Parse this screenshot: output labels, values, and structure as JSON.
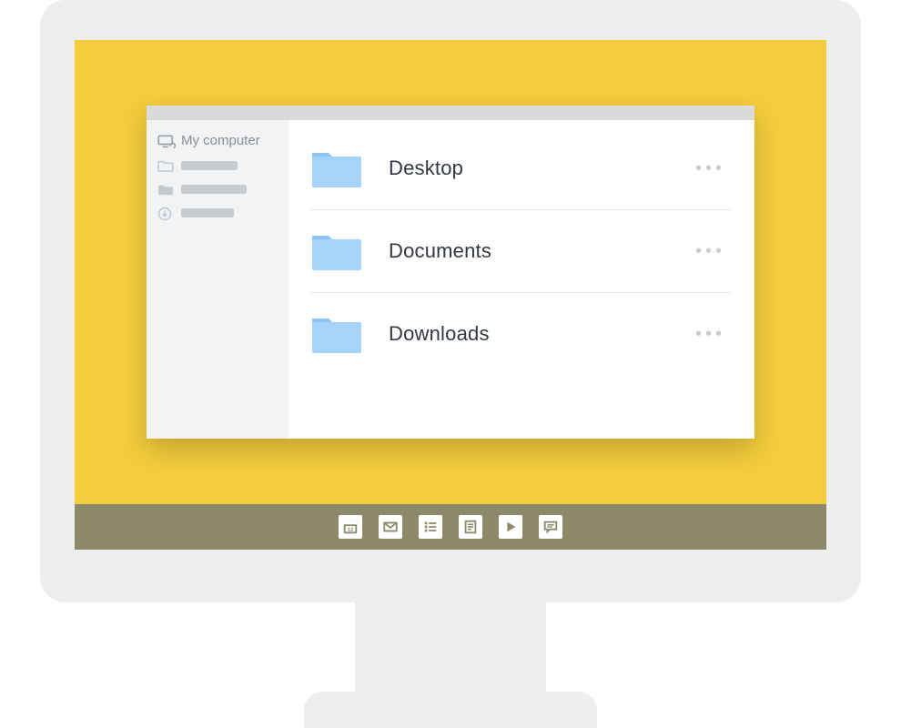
{
  "sidebar": {
    "primary_label": "My computer"
  },
  "folders": [
    {
      "label": "Desktop"
    },
    {
      "label": "Documents"
    },
    {
      "label": "Downloads"
    }
  ],
  "colors": {
    "desktop_bg": "#f4cd3c",
    "taskbar_bg": "#8d8869",
    "folder_fill": "#a6d3fa",
    "folder_tab": "#8cc4f4"
  }
}
